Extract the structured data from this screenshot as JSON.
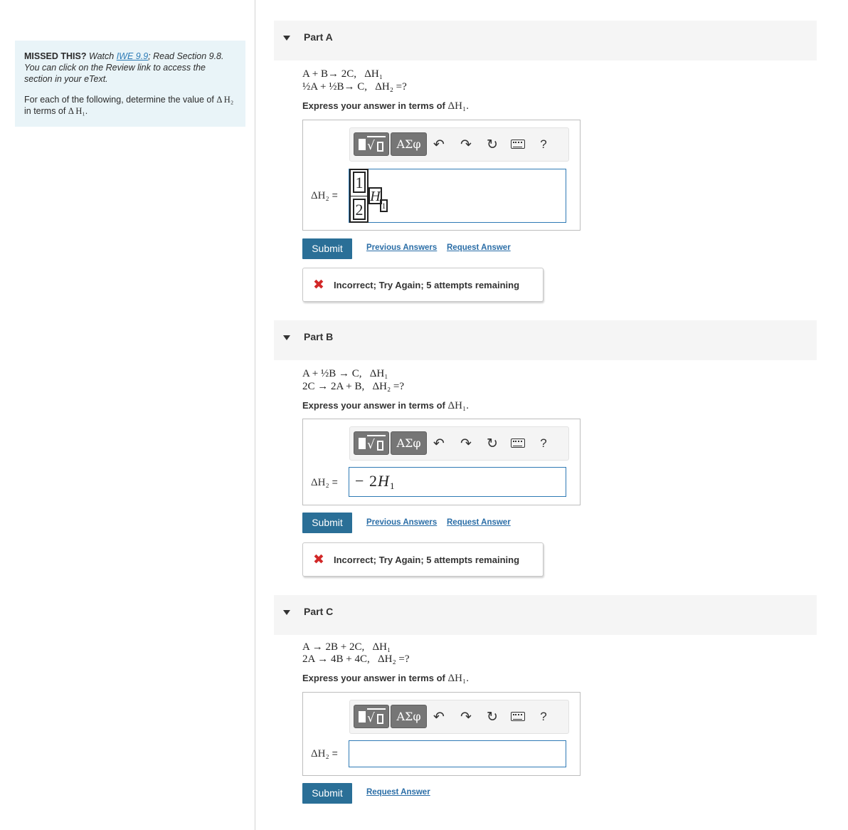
{
  "colors": {
    "info_bg": "#e9f4f8",
    "link": "#2b6ea7",
    "submit_bg": "#2a6f97",
    "error_x": "#d22828",
    "input_border": "#2f7ab5"
  },
  "sidebar": {
    "missed_lead": "MISSED THIS?",
    "watch_prefix": "Watch",
    "watch_link": "IWE 9.9",
    "read_text": "; Read Section 9.8. You can click on the Review link to access the section in your eText.",
    "instruction_prefix": "For each of the following, determine the value of",
    "dh2": "Δ H₂",
    "in_terms_of": "in terms of",
    "dh1": "Δ H₁",
    "period": "."
  },
  "toolbar": {
    "template_icon": "template-radical-icon",
    "greek_label": "ΑΣφ",
    "undo_icon": "undo-icon",
    "redo_icon": "redo-icon",
    "reset_icon": "reset-icon",
    "keyboard_icon": "keyboard-icon",
    "help_label": "?"
  },
  "parts": [
    {
      "label": "Part A",
      "equation_line1": "A + B→ 2C,   ΔH₁",
      "equation_line2": "½A + ½B→ C,   ΔH₂ =?",
      "express_label": "Express your answer in terms of",
      "express_math": "ΔH₁.",
      "answer_label": "ΔH₂",
      "answer_eq": "=",
      "answer_value": {
        "numerator": "1",
        "denominator": "2",
        "var": "H",
        "sub": "1"
      },
      "submit_label": "Submit",
      "previous_answers_label": "Previous Answers",
      "request_answer_label": "Request Answer",
      "feedback_icon": "error-x-icon",
      "feedback_symbol": "✖",
      "feedback_text": "Incorrect; Try Again; 5 attempts remaining"
    },
    {
      "label": "Part B",
      "equation_line1": "A + ½B → C,   ΔH₁",
      "equation_line2": "2C → 2A + B,   ΔH₂ =?",
      "express_label": "Express your answer in terms of",
      "express_math": "ΔH₁.",
      "answer_label": "ΔH₂",
      "answer_eq": "=",
      "answer_value": {
        "minus": "−",
        "coef": "2",
        "var": "H",
        "sub": "1"
      },
      "submit_label": "Submit",
      "previous_answers_label": "Previous Answers",
      "request_answer_label": "Request Answer",
      "feedback_icon": "error-x-icon",
      "feedback_symbol": "✖",
      "feedback_text": "Incorrect; Try Again; 5 attempts remaining"
    },
    {
      "label": "Part C",
      "equation_line1": "A → 2B + 2C,   ΔH₁",
      "equation_line2": "2A → 4B + 4C,   ΔH₂ =?",
      "express_label": "Express your answer in terms of",
      "express_math": "ΔH₁.",
      "answer_label": "ΔH₂",
      "answer_eq": "=",
      "answer_value": "",
      "submit_label": "Submit",
      "request_answer_label": "Request Answer"
    }
  ]
}
